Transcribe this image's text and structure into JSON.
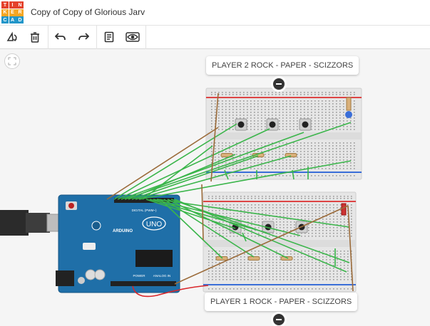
{
  "app": {
    "logo_letters": [
      "T",
      "I",
      "N",
      "K",
      "E",
      "R",
      "C",
      "A",
      "D"
    ],
    "logo_colors": [
      "#e4412b",
      "#e4412b",
      "#e4412b",
      "#f5a623",
      "#f5a623",
      "#f5a623",
      "#2196c9",
      "#2196c9",
      "#2196c9"
    ],
    "document_title": "Copy of Copy of Glorious Jarv"
  },
  "toolbar": {
    "items": [
      {
        "name": "rotate-icon"
      },
      {
        "name": "delete-icon"
      },
      {
        "name": "undo-icon"
      },
      {
        "name": "redo-icon"
      },
      {
        "name": "notes-icon"
      },
      {
        "name": "visibility-icon"
      }
    ]
  },
  "canvas": {
    "zoom_fit_icon": "fit-to-view-icon",
    "callouts": [
      {
        "text": "PLAYER 2 ROCK - PAPER - SCIZZORS"
      },
      {
        "text": "PLAYER 1 ROCK - PAPER - SCIZZORS"
      }
    ],
    "arduino": {
      "brand": "ARDUINO",
      "model": "UNO",
      "header_digital": "DIGITAL (PWM~)",
      "header_power": "POWER",
      "header_analog": "ANALOG IN"
    },
    "colors": {
      "board": "#1f6fa8",
      "breadboard": "#e8e8e8",
      "wire_green": "#3ab54a",
      "wire_brown": "#9b6b3a",
      "wire_red": "#d9262a"
    }
  }
}
